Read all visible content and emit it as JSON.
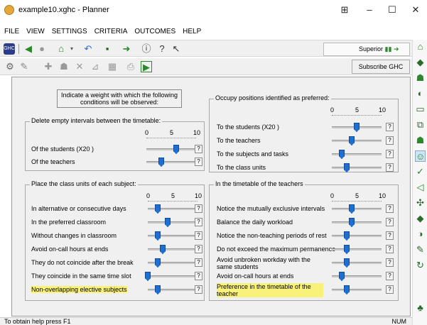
{
  "window": {
    "title": "example10.xghc - Planner",
    "controls": {
      "restore": "⊞",
      "minimize": "–",
      "maximize": "☐",
      "close": "✕"
    }
  },
  "menu": [
    "FILE",
    "VIEW",
    "SETTINGS",
    "CRITERIA",
    "OUTCOMES",
    "HELP"
  ],
  "toolbar": {
    "superior_label": "Superior",
    "subscribe_label": "Subscribe GHC"
  },
  "notice": "Indicate a weight with which the following conditions will be observed:",
  "scale_labels": [
    "0",
    "5",
    "10"
  ],
  "help_label": "?",
  "groups": {
    "delete_intervals": {
      "title": "Delete empty intervals between the timetable:",
      "rows": [
        {
          "label": "Of the students  (X20 )",
          "value": 6
        },
        {
          "label": "Of the teachers",
          "value": 3
        }
      ]
    },
    "occupy_positions": {
      "title": "Occupy positions identified as preferred:",
      "rows": [
        {
          "label": "To the students  (X20 )",
          "value": 5
        },
        {
          "label": "To the teachers",
          "value": 4
        },
        {
          "label": "To the subjects and tasks",
          "value": 2
        },
        {
          "label": "To the class units",
          "value": 3
        }
      ]
    },
    "class_units": {
      "title": "Place the class units of each subject:",
      "rows": [
        {
          "label": "In alternative or consecutive days",
          "value": 2
        },
        {
          "label": "In the preferred classroom",
          "value": 4
        },
        {
          "label": "Without changes in classroom",
          "value": 2
        },
        {
          "label": "Avoid on-call hours at ends",
          "value": 3
        },
        {
          "label": "They do not coincide after the break",
          "value": 2
        },
        {
          "label": "They coincide in the same time slot",
          "value": 0
        },
        {
          "label": "Non-overlapping elective subjects",
          "value": 2,
          "highlighted": true
        }
      ]
    },
    "teachers_timetable": {
      "title": "In the timetable of the teachers",
      "rows": [
        {
          "label": "Notice the mutually exclusive intervals",
          "value": 4
        },
        {
          "label": "Balance the daily workload",
          "value": 4
        },
        {
          "label": "Notice the non-teaching periods of rest",
          "value": 3
        },
        {
          "label": "Do not exceed the maximum permanence",
          "value": 3
        },
        {
          "label": "Avoid unbroken workday with the same students",
          "value": 3
        },
        {
          "label": "Avoid on-call hours at ends",
          "value": 2
        },
        {
          "label": "Preference in the timetable of the teacher",
          "value": 3,
          "highlighted": true
        }
      ]
    }
  },
  "status": {
    "text": "To obtain help press F1",
    "num": "NUM"
  }
}
